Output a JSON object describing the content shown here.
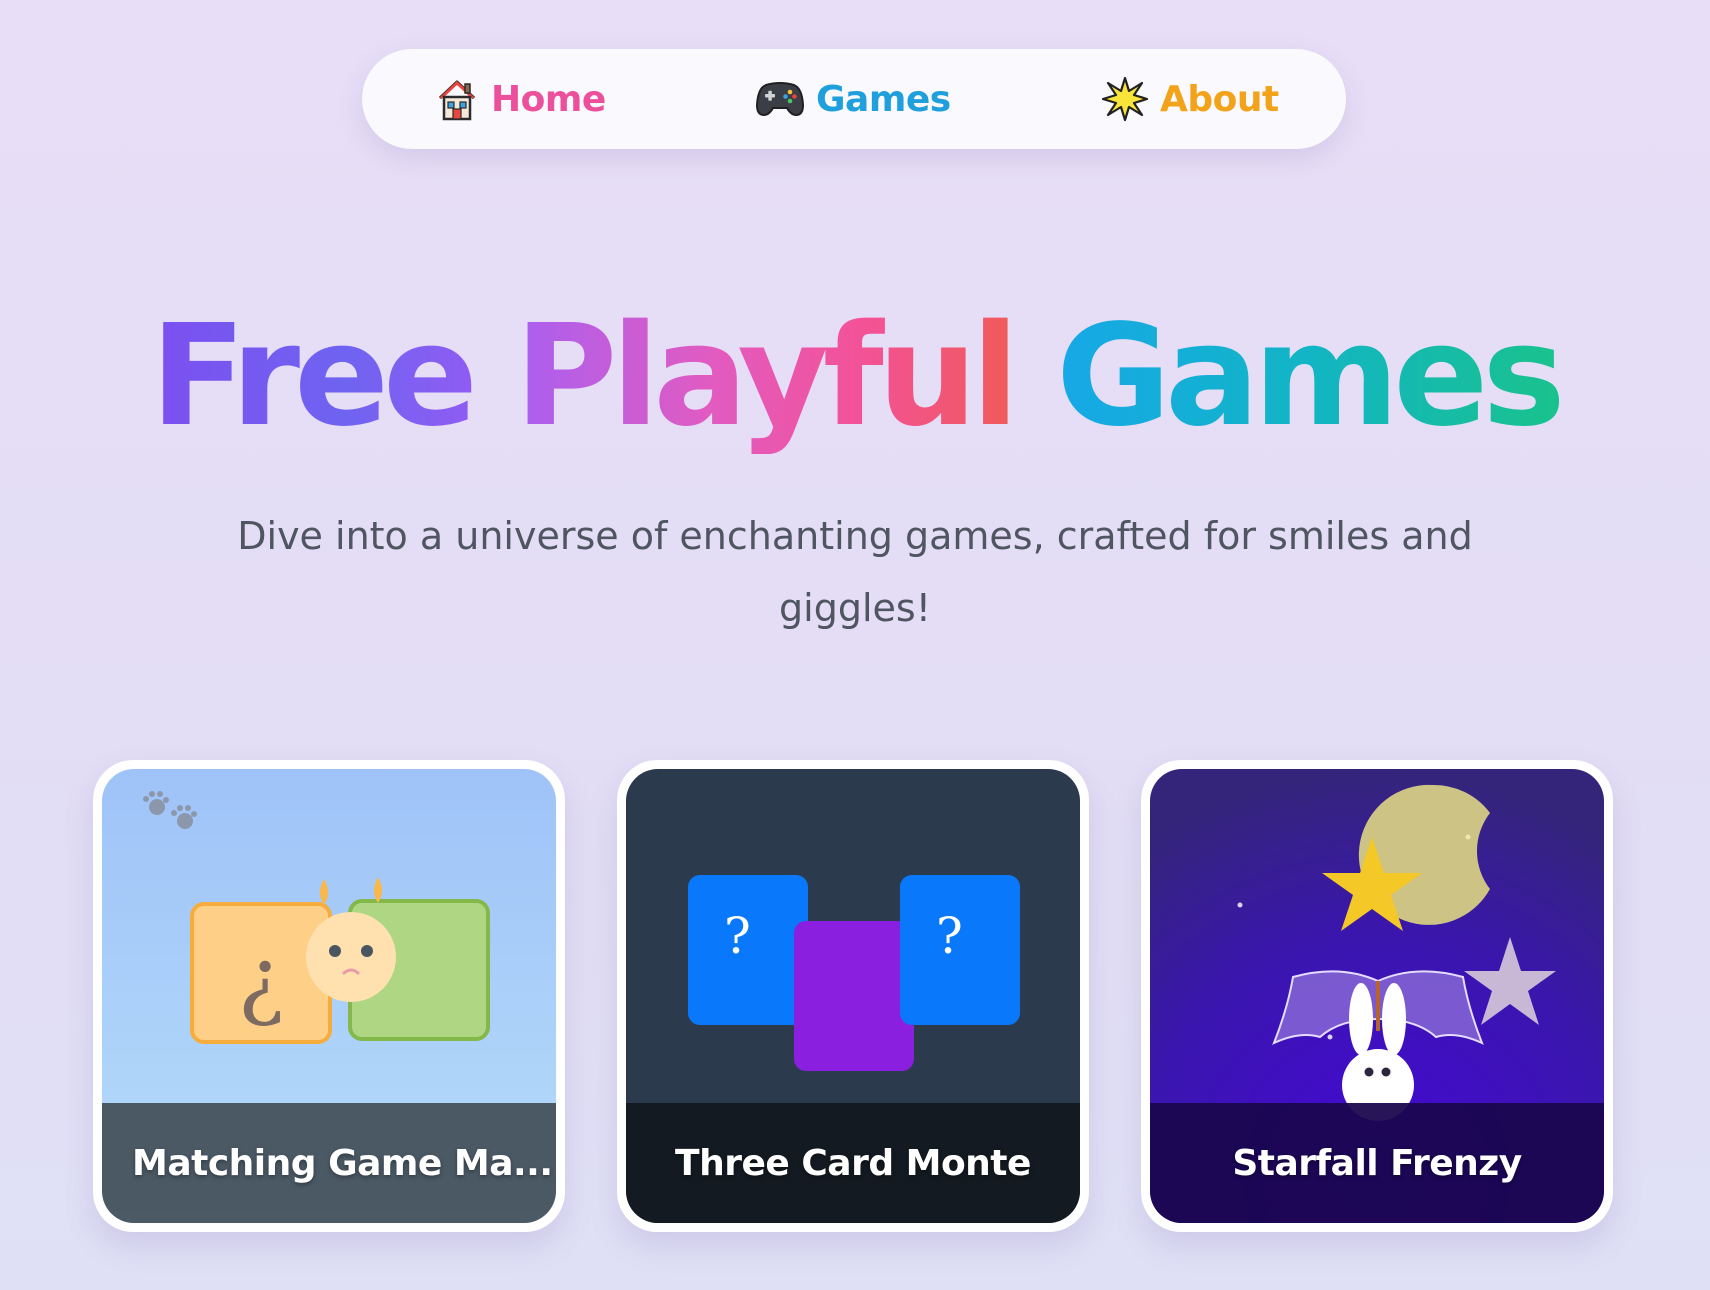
{
  "nav": {
    "items": [
      {
        "label": "Home",
        "icon": "house-icon",
        "color": "#ec4f9b"
      },
      {
        "label": "Games",
        "icon": "gamepad-icon",
        "color": "#1f9fdc"
      },
      {
        "label": "About",
        "icon": "sparkle-star-icon",
        "color": "#f3a31a"
      }
    ]
  },
  "hero": {
    "title_words": [
      "Free",
      "Playful",
      "Games"
    ],
    "subtitle": "Dive into a universe of enchanting games, crafted for smiles and giggles!"
  },
  "games": [
    {
      "title": "Matching Game Ma...",
      "art": "matching-cards-illustration",
      "bg": "#a6c8f7"
    },
    {
      "title": "Three Card Monte",
      "art": "three-cards-illustration",
      "bg": "#2b3a4c"
    },
    {
      "title": "Starfall Frenzy",
      "art": "night-sky-bunny-illustration",
      "bg": "#3a16b0"
    }
  ],
  "colors": {
    "accent_pink": "#ec4f9b",
    "accent_blue": "#1f9fdc",
    "accent_orange": "#f3a31a"
  }
}
